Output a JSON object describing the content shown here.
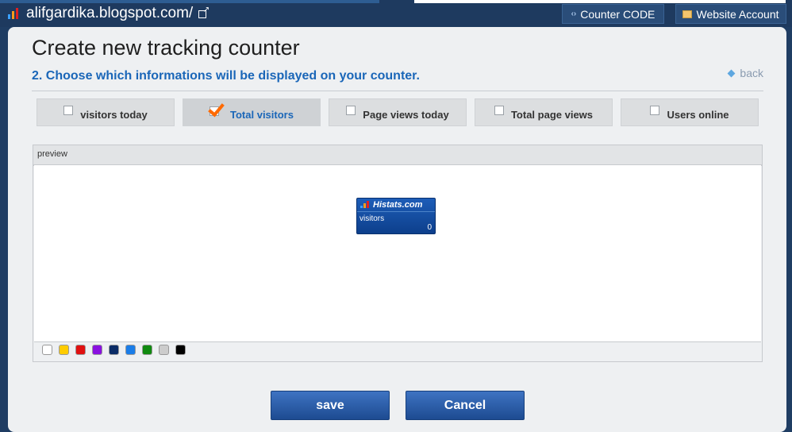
{
  "header": {
    "site_url": "alifgardika.blogspot.com/",
    "buttons": [
      {
        "label": "Counter CODE",
        "icon": "code-icon"
      },
      {
        "label": "Website Account",
        "icon": "folder-icon"
      }
    ]
  },
  "page": {
    "title": "Create new tracking counter",
    "subtitle": "2. Choose which informations will be displayed on your counter.",
    "back_label": "back"
  },
  "options": [
    {
      "label": "visitors today",
      "checked": false
    },
    {
      "label": "Total visitors",
      "checked": true
    },
    {
      "label": "Page views today",
      "checked": false
    },
    {
      "label": "Total page views",
      "checked": false
    },
    {
      "label": "Users online",
      "checked": false
    }
  ],
  "preview": {
    "label": "preview",
    "counter": {
      "brand": "Histats.com",
      "label": "visitors",
      "value": "0"
    },
    "colors": [
      "#ffffff",
      "#ffcc00",
      "#e01010",
      "#8a10e0",
      "#0b2c66",
      "#1a7de8",
      "#108a10",
      "#cccccc",
      "#000000"
    ]
  },
  "actions": {
    "save_label": "save",
    "cancel_label": "Cancel"
  },
  "colors": {
    "accent": "#1a66b8",
    "check": "#ff6a00",
    "button": "#2a5aa6"
  }
}
